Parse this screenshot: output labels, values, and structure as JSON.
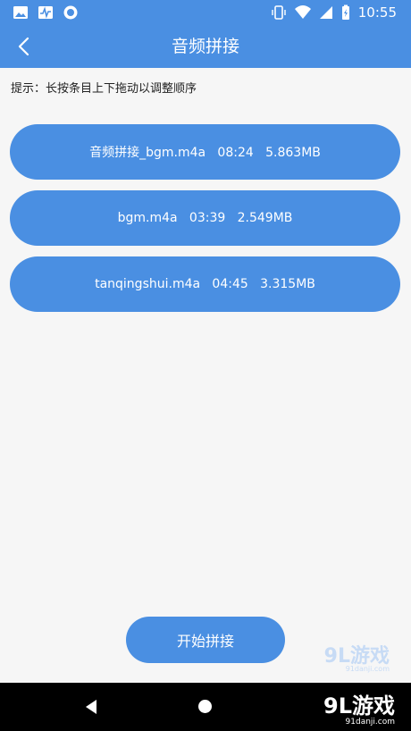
{
  "status_bar": {
    "time": "10:55"
  },
  "header": {
    "title": "音频拼接"
  },
  "hint": "提示：长按条目上下拖动以调整顺序",
  "tracks": [
    {
      "label": "音频拼接_bgm.m4a   08:24   5.863MB"
    },
    {
      "label": "bgm.m4a   03:39   2.549MB"
    },
    {
      "label": "tanqingshui.m4a   04:45   3.315MB"
    }
  ],
  "start_button": "开始拼接",
  "watermark": {
    "brand": "9L游戏",
    "site": "91danji.com"
  },
  "colors": {
    "accent": "#4a8fe2",
    "background": "#f6f6f6"
  }
}
